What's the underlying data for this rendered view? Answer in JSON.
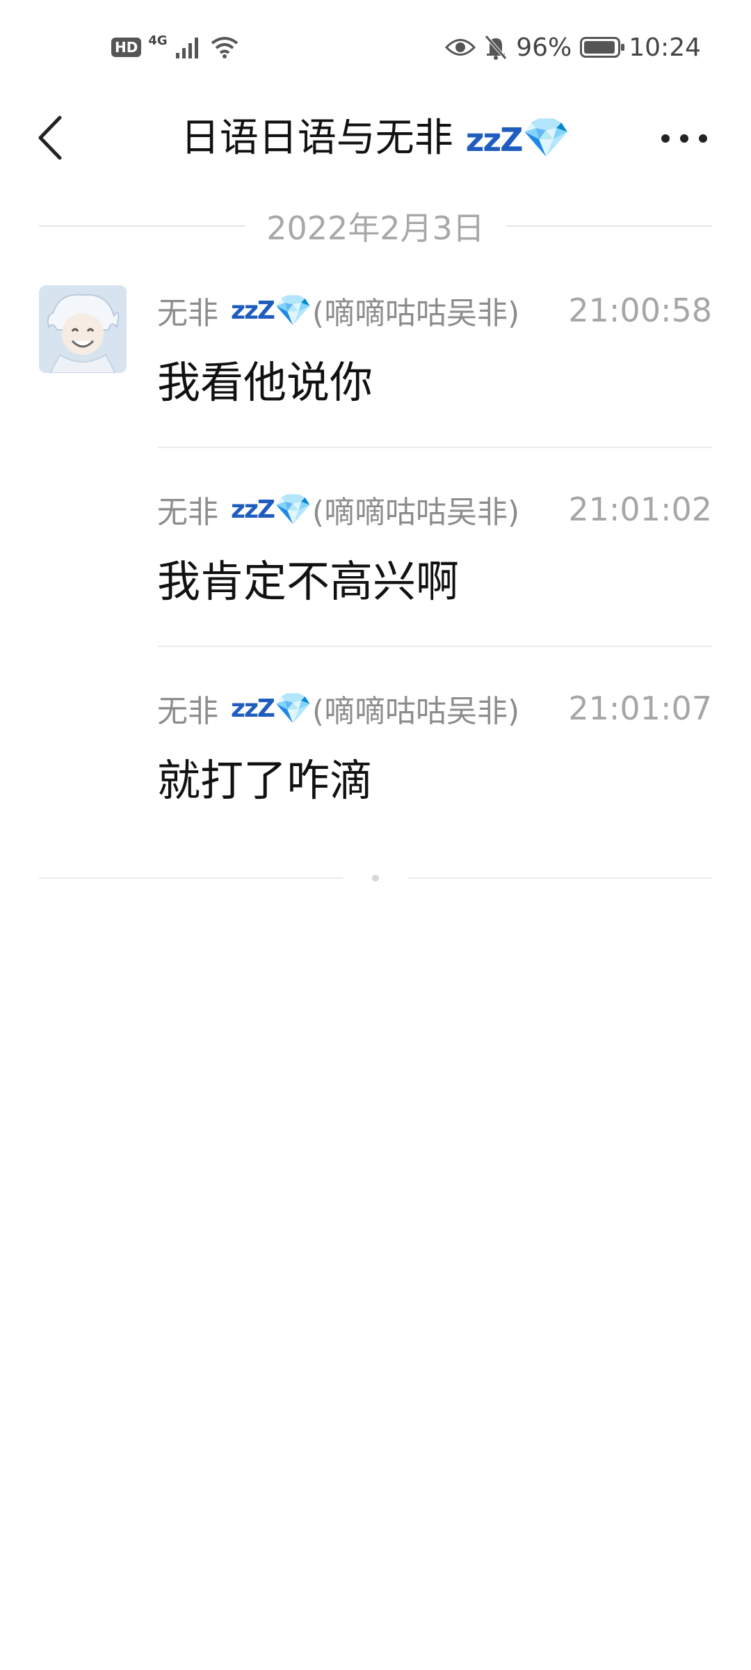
{
  "status_bar": {
    "hd_badge": "HD",
    "network": "4G",
    "battery_percent": "96%",
    "battery_level": 0.96,
    "time": "10:24",
    "icons": [
      "hd-icon",
      "signal-icon",
      "wifi-icon",
      "eye-icon",
      "bell-mute-icon",
      "battery-icon"
    ]
  },
  "nav": {
    "title_text": "日语日语与无非",
    "title_zzz": "zzZ",
    "title_gem": "💎",
    "back_icon": "chevron-left-icon",
    "more_icon": "more-dots-icon"
  },
  "date_divider": "2022年2月3日",
  "messages": [
    {
      "sender_name": "无非",
      "sender_zzz": "zzZ",
      "sender_gem": "💎",
      "sender_nick": "(嘀嘀咕咕吴非)",
      "time": "21:00:58",
      "text": "我看他说你"
    },
    {
      "sender_name": "无非",
      "sender_zzz": "zzZ",
      "sender_gem": "💎",
      "sender_nick": "(嘀嘀咕咕吴非)",
      "time": "21:01:02",
      "text": "我肯定不高兴啊"
    },
    {
      "sender_name": "无非",
      "sender_zzz": "zzZ",
      "sender_gem": "💎",
      "sender_nick": "(嘀嘀咕咕吴非)",
      "time": "21:01:07",
      "text": "就打了咋滴"
    }
  ],
  "colors": {
    "accent_zzz": "#1f5cbf",
    "gem": "#4fb4e8",
    "muted_text": "#8c8c8c",
    "divider": "#ededed"
  }
}
